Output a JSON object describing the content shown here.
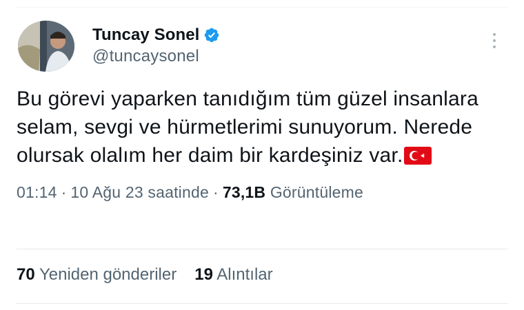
{
  "tweet": {
    "display_name": "Tuncay Sonel",
    "handle": "@tuncaysonel",
    "verified_icon": "verified-badge-icon",
    "more_icon": "more-options-icon",
    "text": "Bu görevi yaparken tanıdığım tüm güzel insanlara selam, sevgi ve hürmetlerimi sunuyorum. Nerede olursak olalım her daim bir kardeşiniz var.",
    "emoji": "turkey-flag-emoji",
    "time": "01:14",
    "date": "10 Ağu 23 saatinde",
    "views_count": "73,1B",
    "views_label": "Görüntüleme",
    "separator": "·"
  },
  "stats": {
    "retweets_count": "70",
    "retweets_label": "Yeniden gönderiler",
    "quotes_count": "19",
    "quotes_label": "Alıntılar"
  },
  "colors": {
    "verified": "#1d9bf0",
    "secondary_text": "#536471",
    "primary_text": "#0f1419",
    "flag_red": "#e30a17"
  }
}
